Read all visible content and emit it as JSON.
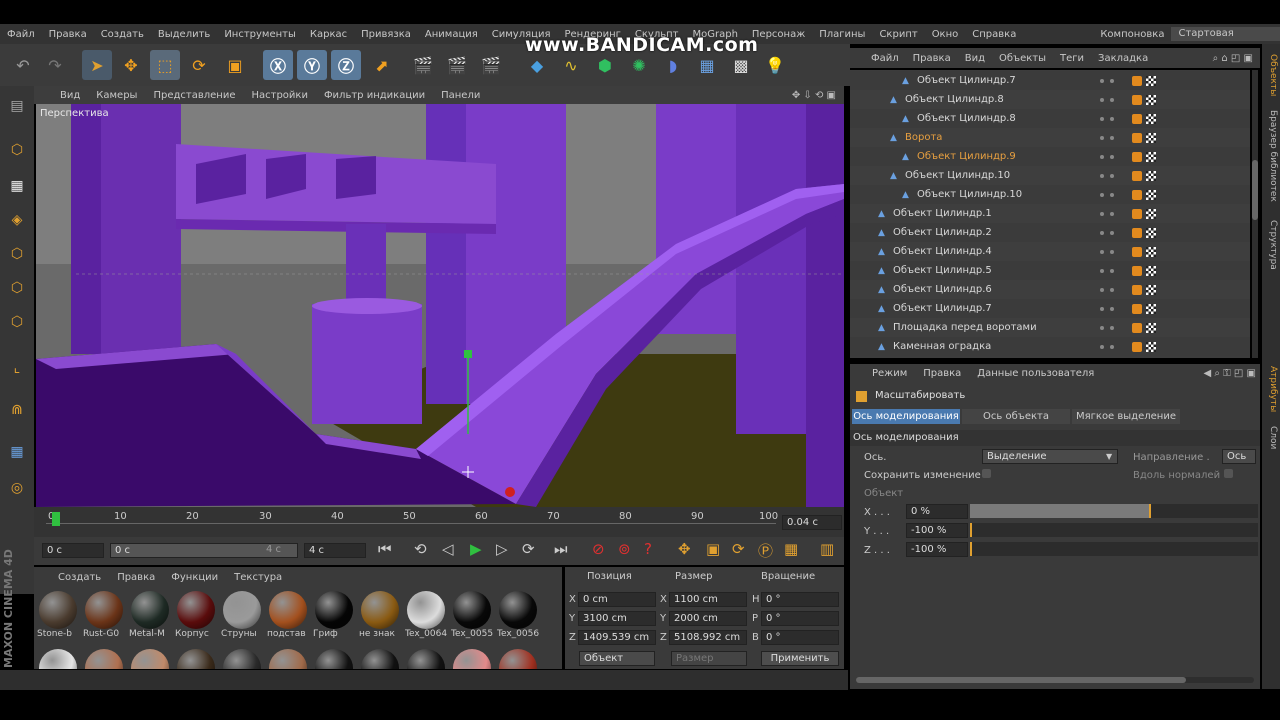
{
  "watermark": "www.BANDICAM.com",
  "menu": [
    "Файл",
    "Правка",
    "Создать",
    "Выделить",
    "Инструменты",
    "Каркас",
    "Привязка",
    "Анимация",
    "Симуляция",
    "Рендеринг",
    "Скульпт",
    "MoGraph",
    "Персонаж",
    "Плагины",
    "Скрипт",
    "Окно",
    "Справка"
  ],
  "layout": {
    "label": "Компоновка",
    "value": "Стартовая"
  },
  "viewport": {
    "menu": [
      "Вид",
      "Камеры",
      "Представление",
      "Настройки",
      "Фильтр индикации",
      "Панели"
    ],
    "label": "Перспектива"
  },
  "timeline": {
    "ticks": [
      "0",
      "10",
      "20",
      "30",
      "40",
      "50",
      "60",
      "70",
      "80",
      "90",
      "100"
    ],
    "current": "0.04 c"
  },
  "transport": {
    "start": "0 c",
    "slider": "0 c",
    "slider_end": "4 c",
    "end": "4 c"
  },
  "materials": {
    "menu": [
      "Создать",
      "Правка",
      "Функции",
      "Текстура"
    ],
    "row1": [
      {
        "name": "Stone-b",
        "color": "#4a3b2e"
      },
      {
        "name": "Rust-G0",
        "color": "#6b3418"
      },
      {
        "name": "Metal-M",
        "color": "#1e2a24"
      },
      {
        "name": "Корпус",
        "color": "#5a0c0c"
      },
      {
        "name": "Струны",
        "color": "#9a9a9a"
      },
      {
        "name": "подстав",
        "color": "#a3501e"
      },
      {
        "name": "Гриф",
        "color": "#050505"
      },
      {
        "name": "не знак",
        "color": "#8a5a12"
      },
      {
        "name": "Tex_0064",
        "color": "#dcdcdc"
      },
      {
        "name": "Tex_0055",
        "color": "#080808"
      },
      {
        "name": "Tex_0056",
        "color": "#080808"
      }
    ],
    "row2": [
      "#e6e6e6",
      "#b07050",
      "#c08a6a",
      "#3a2a1a",
      "#2a2a2a",
      "#a06a4a",
      "#111111",
      "#111111",
      "#111111",
      "#e28a8a",
      "#a03020"
    ]
  },
  "coords": {
    "headers": {
      "position": "Позиция",
      "size": "Размер",
      "rotation": "Вращение"
    },
    "labels": {
      "x": "X",
      "y": "Y",
      "z": "Z",
      "h": "H",
      "p": "P",
      "b": "B"
    },
    "position": [
      "0 cm",
      "3100 cm",
      "1409.539 cm"
    ],
    "size": [
      "1100 cm",
      "2000 cm",
      "5108.992 cm"
    ],
    "rotation": [
      "0 °",
      "0 °",
      "0 °"
    ],
    "mode": "Объект",
    "size_mode": "Размер",
    "apply": "Применить"
  },
  "object_manager": {
    "menu": [
      "Файл",
      "Правка",
      "Вид",
      "Объекты",
      "Теги",
      "Закладка"
    ],
    "items": [
      {
        "name": "Объект Цилиндр.7",
        "indent": 2,
        "color": "#d8d8d8"
      },
      {
        "name": "Объект Цилиндр.8",
        "indent": 1,
        "color": "#d8d8d8"
      },
      {
        "name": "Объект Цилиндр.8",
        "indent": 2,
        "color": "#d8d8d8"
      },
      {
        "name": "Ворота",
        "indent": 1,
        "color": "#e8a040"
      },
      {
        "name": "Объект Цилиндр.9",
        "indent": 2,
        "color": "#e8a040"
      },
      {
        "name": "Объект Цилиндр.10",
        "indent": 1,
        "color": "#d8d8d8"
      },
      {
        "name": "Объект Цилиндр.10",
        "indent": 2,
        "color": "#d8d8d8"
      },
      {
        "name": "Объект Цилиндр.1",
        "indent": 0,
        "color": "#d8d8d8"
      },
      {
        "name": "Объект Цилиндр.2",
        "indent": 0,
        "color": "#d8d8d8"
      },
      {
        "name": "Объект Цилиндр.4",
        "indent": 0,
        "color": "#d8d8d8"
      },
      {
        "name": "Объект Цилиндр.5",
        "indent": 0,
        "color": "#d8d8d8"
      },
      {
        "name": "Объект Цилиндр.6",
        "indent": 0,
        "color": "#d8d8d8"
      },
      {
        "name": "Объект Цилиндр.7",
        "indent": 0,
        "color": "#d8d8d8"
      },
      {
        "name": "Площадка перед воротами",
        "indent": 0,
        "color": "#d8d8d8"
      },
      {
        "name": "Каменная оградка",
        "indent": 0,
        "color": "#d8d8d8"
      }
    ]
  },
  "attributes": {
    "menu": [
      "Режим",
      "Правка",
      "Данные пользователя"
    ],
    "tool": "Масштабировать",
    "tabs": [
      "Ось моделирования",
      "Ось объекта",
      "Мягкое выделение"
    ],
    "section": "Ось моделирования",
    "axis_label": "Ось.",
    "axis_value": "Выделение",
    "direction_label": "Направление .",
    "direction_value": "Ось",
    "keep_label": "Сохранить изменение",
    "normals_label": "Вдоль нормалей",
    "object_label": "Объект",
    "x_label": "X . . .",
    "y_label": "Y . . .",
    "z_label": "Z . . .",
    "x_value": "0 %",
    "y_value": "-100 %",
    "z_value": "-100 %",
    "x_fill": 0.63,
    "y_fill": 0.0,
    "z_fill": 0.0
  },
  "sidetabs": [
    "Объекты",
    "Браузер библиотек",
    "Структура",
    "Атрибуты",
    "Слои"
  ],
  "branding": "MAXON CINEMA 4D"
}
